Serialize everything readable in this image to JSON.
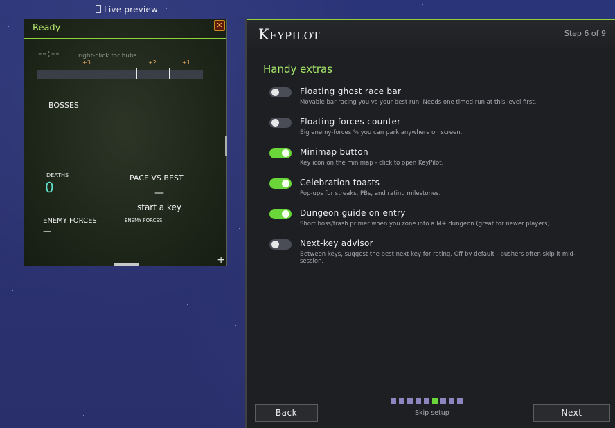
{
  "live_preview": {
    "label": "Live preview"
  },
  "preview": {
    "title": "Ready",
    "close_icon": "close-icon",
    "timer": "--:--",
    "hint": "right-click for hubs",
    "markers": [
      "+3",
      "+2",
      "+1"
    ],
    "bosses_label": "BOSSES",
    "deaths_label": "DEATHS",
    "deaths_value": "0",
    "pace_label": "PACE VS BEST",
    "pace_value": "—",
    "start_key": "start a key",
    "enemy_forces_label": "ENEMY FORCES",
    "enemy_forces_value": "—",
    "enemy_forces_label_small": "ENEMY FORCES",
    "enemy_forces_value_small": "--",
    "resize_icon": "plus-icon"
  },
  "wizard": {
    "brand": {
      "cap": "K",
      "rest": "EYPILOT"
    },
    "step": "Step 6 of 9",
    "section_title": "Handy extras",
    "options": [
      {
        "label": "Floating ghost race bar",
        "desc": "Movable bar racing you vs your best run. Needs one timed run at this level first.",
        "enabled": false
      },
      {
        "label": "Floating forces counter",
        "desc": "Big enemy-forces % you can park anywhere on screen.",
        "enabled": false
      },
      {
        "label": "Minimap button",
        "desc": "Key icon on the minimap - click to open KeyPilot.",
        "enabled": true
      },
      {
        "label": "Celebration toasts",
        "desc": "Pop-ups for streaks, PBs, and rating milestones.",
        "enabled": true
      },
      {
        "label": "Dungeon guide on entry",
        "desc": "Short boss/trash primer when you zone into a M+ dungeon (great for newer players).",
        "enabled": true
      },
      {
        "label": "Next-key advisor",
        "desc": "Between keys, suggest the best next key for rating. Off by default - pushers often skip it mid-session.",
        "enabled": false
      }
    ],
    "progress": {
      "current": 6,
      "total": 9
    },
    "skip_label": "Skip setup",
    "back_label": "Back",
    "next_label": "Next"
  },
  "colors": {
    "accent": "#8fd23c",
    "toggle_on": "#6bd63a",
    "toggle_off": "#4a4d56",
    "title_green": "#a7e86a"
  }
}
